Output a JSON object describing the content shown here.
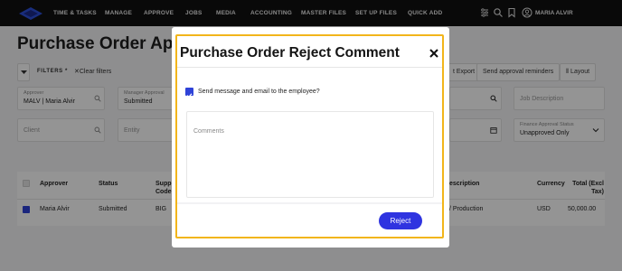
{
  "nav": {
    "items": [
      "TIME & TASKS",
      "MANAGE",
      "APPROVE",
      "JOBS",
      "MEDIA",
      "ACCOUNTING",
      "MASTER FILES",
      "SET UP FILES",
      "QUICK ADD"
    ],
    "user_name": "MARIA ALVIR",
    "icons": [
      "sliders-icon",
      "search-icon",
      "bookmark-icon",
      "user-circle-icon"
    ]
  },
  "page": {
    "title": "Purchase Order Approv",
    "filters_label": "FILTERS *",
    "clear_filters": "Clear filters",
    "toolbar": {
      "export": "t Export",
      "send_reminders": "Send approval reminders",
      "layout": "Layout"
    },
    "fields": {
      "approver_label": "Approver",
      "approver_value": "MALV | Maria Alvir",
      "manager_approval_label": "Manager Approval",
      "manager_approval_value": "Submitted",
      "job_description_placeholder": "Job Description",
      "finance_status_label": "Finance Approval Status",
      "finance_status_value": "Unapproved Only",
      "client_placeholder": "Client",
      "entity_placeholder": "Entity"
    },
    "table": {
      "headers": {
        "approver": "Approver",
        "status": "Status",
        "supp_line1": "Supp",
        "supp_line2": "Code",
        "description": "escription",
        "currency": "Currency",
        "total_line1": "Total (Excl",
        "total_line2": "Tax)"
      },
      "row": {
        "approver": "Maria Alvir",
        "status": "Submitted",
        "supp": "BIG",
        "description": "/ Production",
        "currency": "USD",
        "total": "50,000.00"
      }
    }
  },
  "modal": {
    "title": "Purchase Order Reject Comment",
    "checkbox_label": "Send message and email to the employee?",
    "checkbox_checked": true,
    "comments_placeholder": "Comments",
    "comments_value": "",
    "reject_label": "Reject"
  },
  "colors": {
    "accent": "#2f34e0",
    "highlight_border": "#f2b51b",
    "nav_bg": "#111111"
  }
}
